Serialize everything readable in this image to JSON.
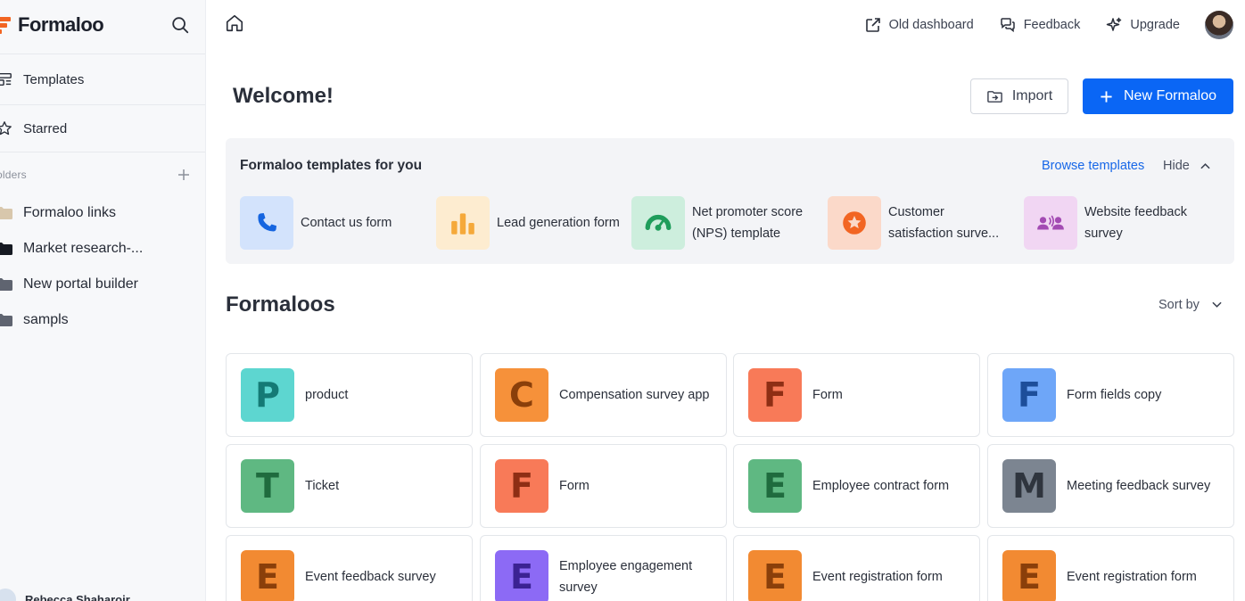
{
  "app": {
    "name": "Formaloo",
    "brand_color": "#f26522"
  },
  "sidebar": {
    "nav": [
      {
        "label": "Templates",
        "icon": "templates-icon"
      },
      {
        "label": "Starred",
        "icon": "star-icon"
      }
    ],
    "folders_label": "olders",
    "folders": [
      "Formaloo links",
      "Market research-...",
      "New portal builder",
      "sampls"
    ],
    "user_name": "Rebecca Shaharoir..."
  },
  "topbar": {
    "old_dashboard": "Old dashboard",
    "feedback": "Feedback",
    "upgrade": "Upgrade"
  },
  "header": {
    "welcome": "Welcome!",
    "import_label": "Import",
    "new_label": "New Formaloo",
    "accent": "#0a66f5"
  },
  "templates": {
    "title": "Formaloo templates for you",
    "browse": "Browse templates",
    "hide": "Hide",
    "items": [
      {
        "name": "Contact us form",
        "icon": "phone-icon",
        "bg": "#d3e3fc",
        "fg": "#1565e0"
      },
      {
        "name": "Lead generation form",
        "icon": "bar-chart-icon",
        "bg": "#fdecd0",
        "fg": "#f5a93a"
      },
      {
        "name": "Net promoter score (NPS) template",
        "icon": "gauge-icon",
        "bg": "#cdeedd",
        "fg": "#1f9d5b"
      },
      {
        "name": "Customer satisfaction surve...",
        "icon": "star-badge-icon",
        "bg": "#fbd9c9",
        "fg": "#f26522"
      },
      {
        "name": "Website feedback survey",
        "icon": "people-icon",
        "bg": "#f1d6f3",
        "fg": "#a34bb3"
      }
    ]
  },
  "formaloos": {
    "title": "Formaloos",
    "sort_label": "Sort by",
    "items": [
      {
        "letter": "P",
        "name": "product",
        "bg": "#5dd6d0",
        "fg": "#147a75"
      },
      {
        "letter": "C",
        "name": "Compensation survey app",
        "bg": "#f6913a",
        "fg": "#8a3f0a"
      },
      {
        "letter": "F",
        "name": "Form",
        "bg": "#f87a58",
        "fg": "#8e2e14"
      },
      {
        "letter": "F",
        "name": "Form fields copy",
        "bg": "#6ea6f8",
        "fg": "#1d4e9a"
      },
      {
        "letter": "T",
        "name": "Ticket",
        "bg": "#5fb882",
        "fg": "#1f6b3e"
      },
      {
        "letter": "F",
        "name": "Form",
        "bg": "#f87a58",
        "fg": "#8e2e14"
      },
      {
        "letter": "E",
        "name": "Employee contract form",
        "bg": "#5fb882",
        "fg": "#1f6b3e"
      },
      {
        "letter": "M",
        "name": "Meeting feedback survey",
        "bg": "#7c8591",
        "fg": "#2f353e"
      },
      {
        "letter": "E",
        "name": "Event feedback survey",
        "bg": "#f28a32",
        "fg": "#8a3f0a"
      },
      {
        "letter": "E",
        "name": "Employee engagement survey",
        "bg": "#8c6af5",
        "fg": "#3b2293"
      },
      {
        "letter": "E",
        "name": "Event registration form",
        "bg": "#f28a32",
        "fg": "#8a3f0a"
      },
      {
        "letter": "E",
        "name": "Event registration form",
        "bg": "#f28a32",
        "fg": "#8a3f0a"
      }
    ]
  }
}
